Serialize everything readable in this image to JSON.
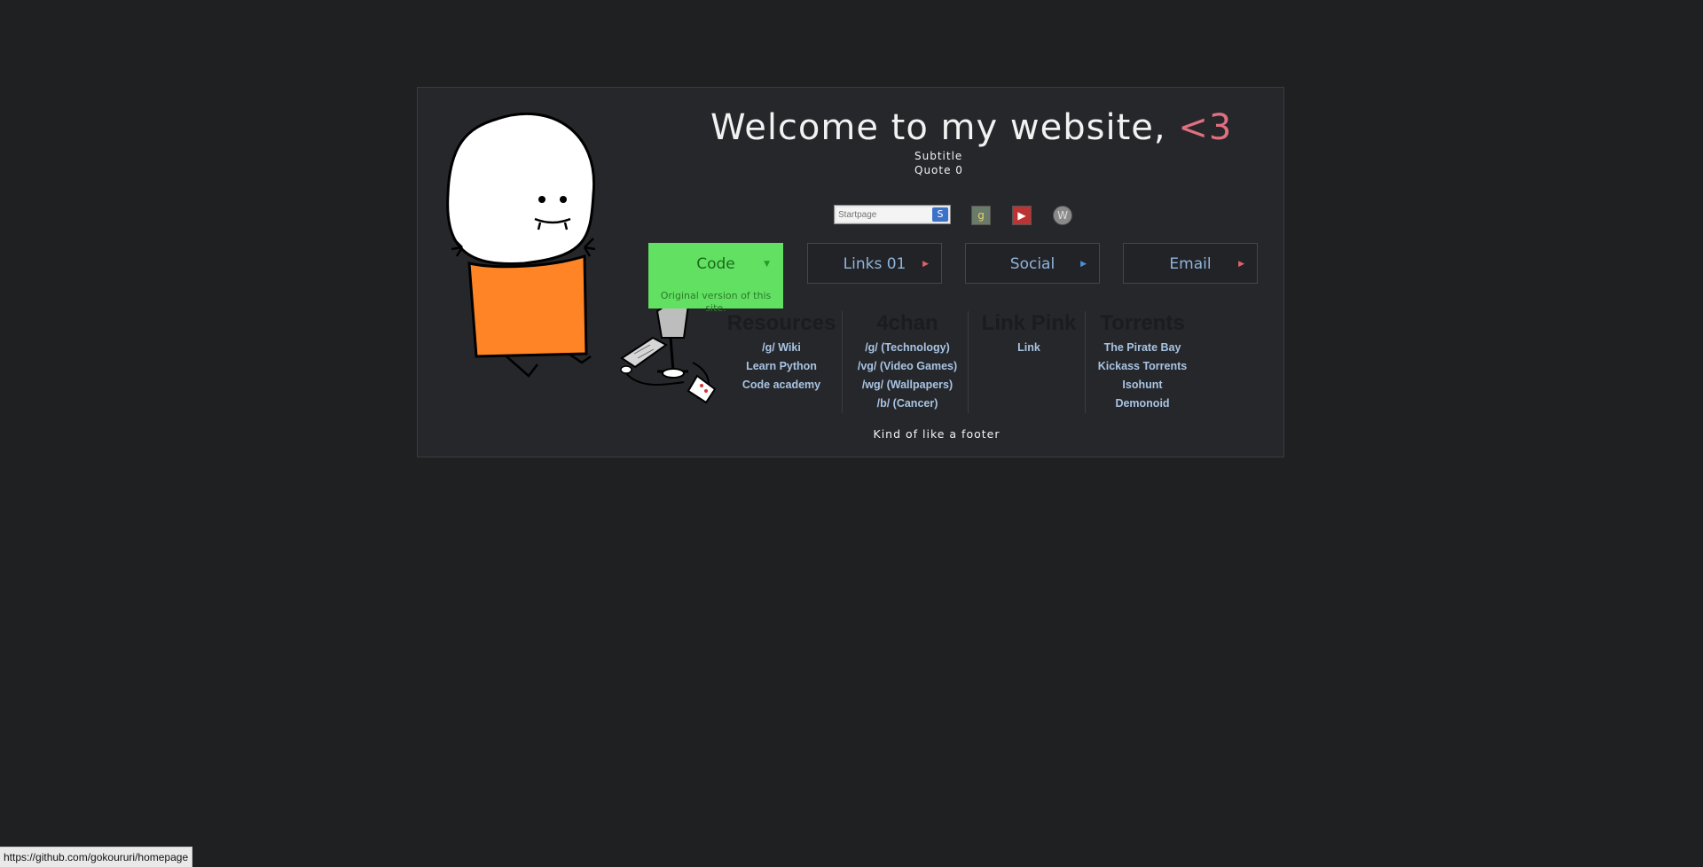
{
  "header": {
    "title": "Welcome to my website,",
    "heart": "<3",
    "subtitle": "Subtitle",
    "quote": "Quote 0"
  },
  "search": {
    "placeholder": "Startpage",
    "go_icon": "startpage-icon"
  },
  "shortcuts": [
    {
      "name": "google",
      "glyph": "g"
    },
    {
      "name": "youtube",
      "glyph": "▶"
    },
    {
      "name": "wikipedia",
      "glyph": "W"
    }
  ],
  "tabs": [
    {
      "label": "Code",
      "description": "Original version of this site."
    },
    {
      "label": "Links 01"
    },
    {
      "label": "Social"
    },
    {
      "label": "Email"
    }
  ],
  "columns": [
    {
      "heading": "Resources",
      "links": [
        "/g/ Wiki",
        "Learn Python",
        "Code academy"
      ]
    },
    {
      "heading": "4chan",
      "links": [
        "/g/ (Technology)",
        "/vg/ (Video Games)",
        "/wg/ (Wallpapers)",
        "/b/ (Cancer)"
      ]
    },
    {
      "heading": "Link Pink",
      "links": [
        "Link"
      ]
    },
    {
      "heading": "Torrents",
      "links": [
        "The Pirate Bay",
        "Kickass Torrents",
        "Isohunt",
        "Demonoid"
      ]
    }
  ],
  "footer": "Kind of like a footer",
  "status_url": "https://github.com/gokoururi/homepage",
  "colors": {
    "background": "#1f2022",
    "panel": "#26272b",
    "accent_green": "#62e062",
    "heart": "#e07080",
    "link": "#a8c4e2"
  }
}
